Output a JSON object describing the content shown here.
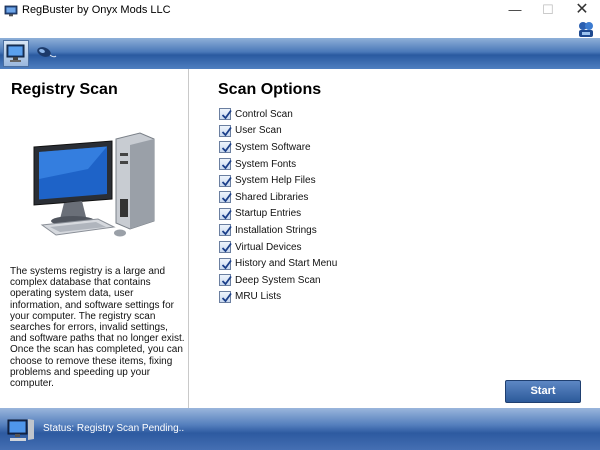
{
  "window": {
    "title": "RegBuster by Onyx Mods LLC",
    "min_glyph": "—",
    "max_glyph": "☐",
    "close_glyph": "✕"
  },
  "toolbar": {
    "items": [
      {
        "icon": "computer-scan-icon",
        "active": true
      },
      {
        "icon": "mouse-icon",
        "active": false
      }
    ]
  },
  "left": {
    "title": "Registry Scan",
    "image_icon": "desktop-computer-icon",
    "description": "The systems registry is a large and complex database that contains operating system data, user information, and software settings for your computer. The registry scan searches for errors, invalid settings, and software paths that no longer exist. Once the scan has completed, you can choose to remove these items, fixing problems and speeding up your computer."
  },
  "right": {
    "title": "Scan Options",
    "options": [
      {
        "label": "Control Scan",
        "checked": true
      },
      {
        "label": "User Scan",
        "checked": true
      },
      {
        "label": "System Software",
        "checked": true
      },
      {
        "label": "System Fonts",
        "checked": true
      },
      {
        "label": "System Help Files",
        "checked": true
      },
      {
        "label": "Shared Libraries",
        "checked": true
      },
      {
        "label": "Startup Entries",
        "checked": true
      },
      {
        "label": "Installation Strings",
        "checked": true
      },
      {
        "label": "Virtual Devices",
        "checked": true
      },
      {
        "label": "History and Start Menu",
        "checked": true
      },
      {
        "label": "Deep System Scan",
        "checked": true
      },
      {
        "label": "MRU Lists",
        "checked": true
      }
    ],
    "start_label": "Start"
  },
  "status": {
    "text": "Status: Registry Scan Pending.."
  },
  "colors": {
    "band_dark": "#2a5aa0",
    "band_light": "#8fb0d8",
    "button": "#3d6aaa"
  }
}
